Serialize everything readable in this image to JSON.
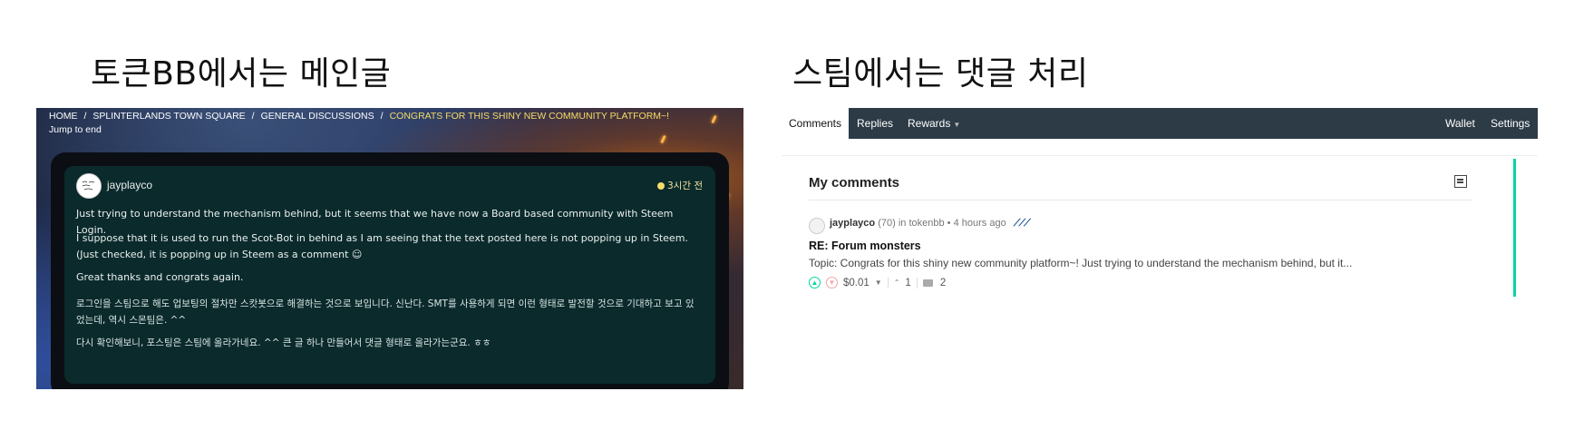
{
  "captions": {
    "left": "토큰BB에서는 메인글",
    "right": "스팀에서는 댓글 처리"
  },
  "forum": {
    "breadcrumb": [
      "HOME",
      "SPLINTERLANDS TOWN SQUARE",
      "GENERAL DISCUSSIONS",
      "CONGRATS FOR THIS SHINY NEW COMMUNITY PLATFORM~!"
    ],
    "jump_to_end": "Jump to end",
    "post": {
      "username": "jayplayco",
      "time": "3시간 전",
      "paragraphs": [
        "Just trying to understand the mechanism behind, but it seems that we have now a Board based community with Steem Login.",
        "I suppose that it is used to run the Scot-Bot in behind as I am seeing that the text posted here is not popping up in Steem. (Just checked, it is popping up in Steem as a comment ☺",
        "Great thanks and congrats again.",
        "로그인을 스팀으로 해도 업보팅의 절차만 스캇봇으로 해결하는 것으로 보입니다. 신난다. SMT를 사용하게 되면 이런 형태로 발전할 것으로 기대하고 보고 있었는데, 역시 스몬팀은. ^^",
        "다시 확인해보니, 포스팅은 스팀에 올라가네요. ^^ 큰 글 하나 만들어서 댓글 형태로 올라가는군요. ㅎㅎ"
      ]
    }
  },
  "steemit": {
    "tabs": [
      "Comments",
      "Replies",
      "Rewards"
    ],
    "right_tabs": [
      "Wallet",
      "Settings"
    ],
    "section_title": "My comments",
    "comment": {
      "author": "jayplayco",
      "reputation": "(70)",
      "in_label": "in",
      "community": "tokenbb",
      "age": "4 hours ago",
      "title": "RE: Forum monsters",
      "topic": "Topic: Congrats for this shiny new community platform~! Just trying to understand the mechanism behind, but it...",
      "payout": "$0.01",
      "votes": "1",
      "replies": "2"
    }
  }
}
